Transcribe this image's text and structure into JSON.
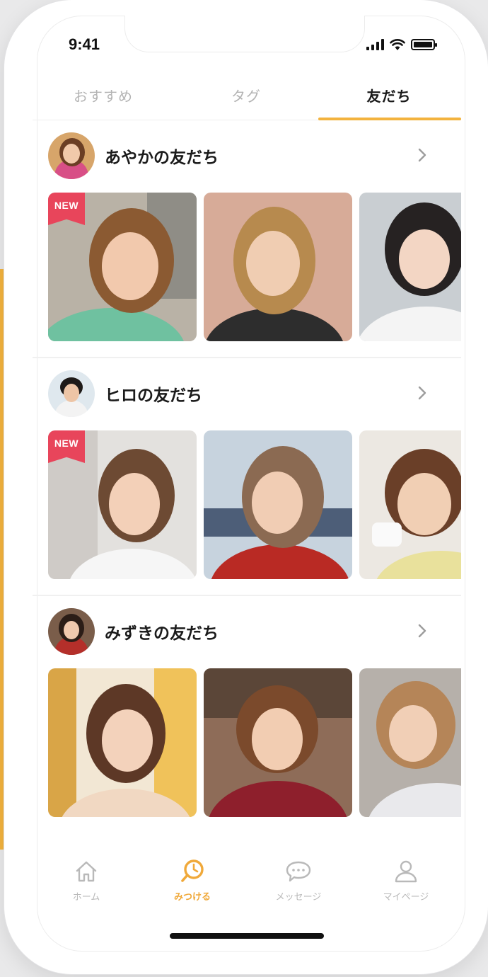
{
  "status_bar": {
    "time": "9:41",
    "icons": [
      "signal-icon",
      "wifi-icon",
      "battery-icon"
    ]
  },
  "tabs": [
    {
      "label": "おすすめ",
      "active": false
    },
    {
      "label": "タグ",
      "active": false
    },
    {
      "label": "友だち",
      "active": true
    }
  ],
  "colors": {
    "accent": "#f3b33e",
    "new_badge": "#e8455b",
    "active_nav": "#f0a93a"
  },
  "sections": [
    {
      "title": "あやかの友だち",
      "chevron_icon": "chevron-right-icon",
      "photos": [
        {
          "badge": "NEW"
        },
        {
          "badge": ""
        },
        {
          "badge": ""
        }
      ]
    },
    {
      "title": "ヒロの友だち",
      "chevron_icon": "chevron-right-icon",
      "photos": [
        {
          "badge": "NEW"
        },
        {
          "badge": ""
        },
        {
          "badge": ""
        }
      ]
    },
    {
      "title": "みずきの友だち",
      "chevron_icon": "chevron-right-icon",
      "photos": [
        {
          "badge": ""
        },
        {
          "badge": ""
        },
        {
          "badge": ""
        }
      ]
    }
  ],
  "bottom_nav": [
    {
      "label": "ホーム",
      "icon": "home-icon",
      "active": false
    },
    {
      "label": "みつける",
      "icon": "search-icon",
      "active": true
    },
    {
      "label": "メッセージ",
      "icon": "chat-bubble-icon",
      "active": false
    },
    {
      "label": "マイページ",
      "icon": "person-icon",
      "active": false
    }
  ]
}
